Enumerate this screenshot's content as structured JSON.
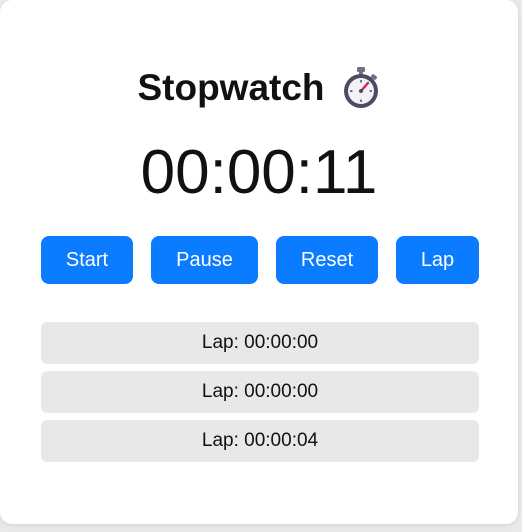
{
  "app": {
    "title": "Stopwatch",
    "title_icon": "stopwatch-icon",
    "time": "00:00:11"
  },
  "controls": {
    "start_label": "Start",
    "pause_label": "Pause",
    "reset_label": "Reset",
    "lap_label": "Lap"
  },
  "laps": [
    {
      "text": "Lap: 00:00:00"
    },
    {
      "text": "Lap: 00:00:00"
    },
    {
      "text": "Lap: 00:00:04"
    }
  ],
  "colors": {
    "primary": "#0b7bff",
    "lap_bg": "#e8e8e8",
    "page_bg": "#e9e9e9",
    "card_bg": "#ffffff",
    "text": "#111111"
  }
}
